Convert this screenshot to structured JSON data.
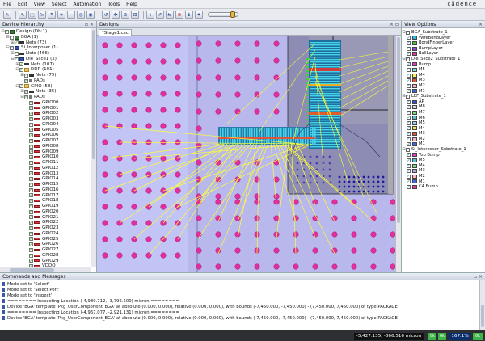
{
  "menu": [
    "File",
    "Edit",
    "View",
    "Select",
    "Automation",
    "Tools",
    "Help"
  ],
  "brand": "cādence",
  "toolbar_icons": [
    "open-icon",
    "select-icon",
    "select-area-icon",
    "select-net-icon",
    "probe-icon",
    "zoom-in-icon",
    "zoom-out-icon",
    "zoom-fit-icon",
    "zoom-area-icon",
    "zoom-prev-icon",
    "pan-icon",
    "zoom-select-icon",
    "measure-icon",
    "route-icon",
    "edit-icon",
    "flip-icon",
    "stop-icon",
    "info-icon",
    "highlight-icon"
  ],
  "hierarchy": {
    "title": "Device Hierarchy",
    "items": [
      {
        "label": "Design (Db:1)",
        "level": 0,
        "icon": "grid",
        "exp": "-"
      },
      {
        "label": "BGA (1)",
        "level": 1,
        "icon": "grid",
        "exp": "-"
      },
      {
        "label": "Nets (73)",
        "level": 2,
        "icon": "net",
        "exp": "+"
      },
      {
        "label": "Si_Interposer (1)",
        "level": 1,
        "icon": "chip",
        "exp": "-"
      },
      {
        "label": "Nets (466)",
        "level": 2,
        "icon": "net",
        "exp": "+"
      },
      {
        "label": "Die_Slice1 (2)",
        "level": 2,
        "icon": "chip",
        "exp": "-"
      },
      {
        "label": "Nets (107)",
        "level": 3,
        "icon": "net",
        "exp": "+"
      },
      {
        "label": "DDR (101)",
        "level": 3,
        "icon": "folder",
        "exp": "-"
      },
      {
        "label": "Nets (75)",
        "level": 4,
        "icon": "net",
        "exp": "+"
      },
      {
        "label": "PADs",
        "level": 4,
        "icon": "pads",
        "exp": ""
      },
      {
        "label": "GPIO (58)",
        "level": 3,
        "icon": "folder",
        "exp": "-"
      },
      {
        "label": "Nets (35)",
        "level": 4,
        "icon": "net",
        "exp": "+"
      },
      {
        "label": "PADs",
        "level": 4,
        "icon": "pads",
        "exp": "-"
      },
      {
        "label": "GPIO00",
        "level": 5,
        "icon": "pad",
        "exp": ""
      },
      {
        "label": "GPIO01",
        "level": 5,
        "icon": "pad",
        "exp": ""
      },
      {
        "label": "GPIO02",
        "level": 5,
        "icon": "pad",
        "exp": ""
      },
      {
        "label": "GPIO03",
        "level": 5,
        "icon": "pad",
        "exp": ""
      },
      {
        "label": "GPIO04",
        "level": 5,
        "icon": "pad",
        "exp": ""
      },
      {
        "label": "GPIO05",
        "level": 5,
        "icon": "pad",
        "exp": ""
      },
      {
        "label": "GPIO06",
        "level": 5,
        "icon": "pad",
        "exp": ""
      },
      {
        "label": "GPIO07",
        "level": 5,
        "icon": "pad",
        "exp": ""
      },
      {
        "label": "GPIO08",
        "level": 5,
        "icon": "pad",
        "exp": ""
      },
      {
        "label": "GPIO09",
        "level": 5,
        "icon": "pad",
        "exp": ""
      },
      {
        "label": "GPIO10",
        "level": 5,
        "icon": "pad",
        "exp": ""
      },
      {
        "label": "GPIO11",
        "level": 5,
        "icon": "pad",
        "exp": ""
      },
      {
        "label": "GPIO12",
        "level": 5,
        "icon": "pad",
        "exp": ""
      },
      {
        "label": "GPIO13",
        "level": 5,
        "icon": "pad",
        "exp": ""
      },
      {
        "label": "GPIO14",
        "level": 5,
        "icon": "pad",
        "exp": ""
      },
      {
        "label": "GPIO15",
        "level": 5,
        "icon": "pad",
        "exp": ""
      },
      {
        "label": "GPIO16",
        "level": 5,
        "icon": "pad",
        "exp": ""
      },
      {
        "label": "GPIO17",
        "level": 5,
        "icon": "pad",
        "exp": ""
      },
      {
        "label": "GPIO18",
        "level": 5,
        "icon": "pad",
        "exp": ""
      },
      {
        "label": "GPIO19",
        "level": 5,
        "icon": "pad",
        "exp": ""
      },
      {
        "label": "GPIO20",
        "level": 5,
        "icon": "pad",
        "exp": ""
      },
      {
        "label": "GPIO21",
        "level": 5,
        "icon": "pad",
        "exp": ""
      },
      {
        "label": "GPIO22",
        "level": 5,
        "icon": "pad",
        "exp": ""
      },
      {
        "label": "GPIO23",
        "level": 5,
        "icon": "pad",
        "exp": ""
      },
      {
        "label": "GPIO24",
        "level": 5,
        "icon": "pad",
        "exp": ""
      },
      {
        "label": "GPIO25",
        "level": 5,
        "icon": "pad",
        "exp": ""
      },
      {
        "label": "GPIO26",
        "level": 5,
        "icon": "pad",
        "exp": ""
      },
      {
        "label": "GPIO27",
        "level": 5,
        "icon": "pad",
        "exp": ""
      },
      {
        "label": "GPIO28",
        "level": 5,
        "icon": "pad",
        "exp": ""
      },
      {
        "label": "GPIO29",
        "level": 5,
        "icon": "pad",
        "exp": ""
      },
      {
        "label": "VDDO",
        "level": 5,
        "icon": "pad",
        "exp": ""
      }
    ]
  },
  "designs": {
    "title": "Designs",
    "tab": "*Stage1.csc"
  },
  "view_options": {
    "title": "View Options",
    "groups": [
      {
        "label": "BGA_Substrate_1",
        "layers": [
          {
            "name": "WireBondLayer",
            "color": "#29b6e8"
          },
          {
            "name": "BondFingerLayer",
            "color": "#46c93a"
          },
          {
            "name": "BumpLayer",
            "color": "#8a48d8"
          },
          {
            "name": "BallLayer",
            "color": "#e03a9a"
          }
        ]
      },
      {
        "label": "Die_Slice2_Substrate_1",
        "layers": [
          {
            "name": "Bump",
            "color": "#e83ccc"
          },
          {
            "name": "M5",
            "color": "#7fe0e6"
          },
          {
            "name": "M4",
            "color": "#f0f05a"
          },
          {
            "name": "M3",
            "color": "#e0553a"
          },
          {
            "name": "M2",
            "color": "#f4b1c8"
          },
          {
            "name": "M1",
            "color": "#3a68e8"
          }
        ]
      },
      {
        "label": "LEF_Substrate_1",
        "layers": [
          {
            "name": "AP",
            "color": "#2e4fd8"
          },
          {
            "name": "M8",
            "color": "#d8d8d8"
          },
          {
            "name": "M7",
            "color": "#7cd87c"
          },
          {
            "name": "M6",
            "color": "#56c0c8"
          },
          {
            "name": "M5",
            "color": "#9ad0f0"
          },
          {
            "name": "M4",
            "color": "#f0e35a"
          },
          {
            "name": "M3",
            "color": "#e0553a"
          },
          {
            "name": "M2",
            "color": "#f4b1c8"
          },
          {
            "name": "M1",
            "color": "#3a68e8"
          }
        ]
      },
      {
        "label": "Si_Interposer_Substrate_1",
        "layers": [
          {
            "name": "Top Bump",
            "color": "#e83ccc"
          },
          {
            "name": "M5",
            "color": "#56c0c8"
          },
          {
            "name": "M4",
            "color": "#7cd87c"
          },
          {
            "name": "M3",
            "color": "#b5a2d8"
          },
          {
            "name": "M2",
            "color": "#f4b1c8"
          },
          {
            "name": "M1",
            "color": "#3a68e8"
          },
          {
            "name": "C4 Bump",
            "color": "#e03a9a"
          }
        ]
      }
    ]
  },
  "commands": {
    "title": "Commands and Messages",
    "lines": [
      "Mode set to 'Select'",
      "Mode set to 'Select Port'",
      "Mode set to 'Inspect'",
      "======== Inspecting Location (-4,980.712, -3,796.500) micron ========",
      "Device 'BGA' template 'Pkg_UserComponent_BGA' at absolute (0.000, 0.000), relative (0.000, 0.000), with bounds (-7,450.000, -7,450.000) - (7,450.000, 7,450.000) of type PACKAGE",
      "======== Inspecting Location (-4,967.077, -2,921.131) micron ========",
      "Device 'BGA' template 'Pkg_UserComponent_BGA' at absolute (0.000, 0.000), relative (0.000, 0.000), with bounds (-7,450.000, -7,450.000) - (7,450.000, 7,450.000) of type PACKAGE"
    ]
  },
  "status": {
    "coords": "-5,427.135, -866.516 micron",
    "zoom": "167.1%",
    "s1": "0k",
    "s2": "0k",
    "s3": "0k"
  },
  "canvas_colors": {
    "package": "#c2c4f5",
    "interposer": "#b8b8ec",
    "die": "#8c8cb4",
    "balls": "#e0309f",
    "wires": "#ffff33"
  }
}
